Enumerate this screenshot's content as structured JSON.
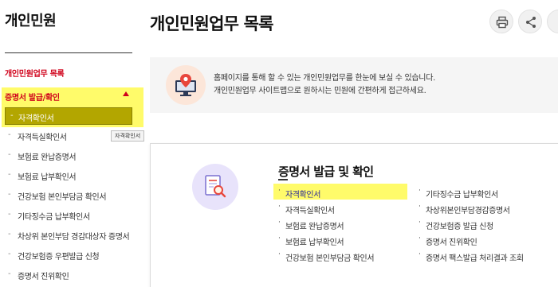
{
  "sidebar": {
    "title": "개인민원",
    "subtitle": "개인민원업무 목록",
    "category": "증명서 발급/확인",
    "active_item": "자격확인서",
    "tooltip": "자격확인서",
    "items": [
      {
        "label": "자격득실확인서"
      },
      {
        "label": "보험료 완납증명서"
      },
      {
        "label": "보험료 납부확인서"
      },
      {
        "label": "건강보험 본인부담금 확인서"
      },
      {
        "label": "기타징수금 납부확인서"
      },
      {
        "label": "차상위 본인부담 경감대상자 증명서"
      },
      {
        "label": "건강보험증 우편발급 신청"
      },
      {
        "label": "증명서 진위확인"
      }
    ]
  },
  "header": {
    "title": "개인민원업무 목록",
    "print_icon": "printer-icon",
    "share_icon": "share-icon",
    "more_icon": "more-icon"
  },
  "info": {
    "icon": "monitor-location-icon",
    "line1": "홈페이지를 통해 할 수 있는 개인민원업무를 한눈에 보실 수 있습니다.",
    "line2": "개인민원업무 사이트맵으로 원하시는 민원에 간편하게 접근하세요."
  },
  "cert": {
    "icon": "document-search-icon",
    "title": "증명서 발급 및 확인",
    "left_items": [
      {
        "label": "자격확인서"
      },
      {
        "label": "자격득실확인서"
      },
      {
        "label": "보험료 완납증명서"
      },
      {
        "label": "보험료 납부확인서"
      },
      {
        "label": "건강보험 본인부담금 확인서"
      }
    ],
    "right_items": [
      {
        "label": "기타징수금 납부확인서"
      },
      {
        "label": "차상위본인부담경감증명서"
      },
      {
        "label": "건강보험증 발급 신청"
      },
      {
        "label": "증명서 진위확인"
      },
      {
        "label": "증명서 팩스발급 처리결과 조회"
      }
    ]
  },
  "colors": {
    "accent_red": "#d0021b",
    "highlight_yellow": "#fffb6a",
    "active_olive": "#b3a600"
  }
}
